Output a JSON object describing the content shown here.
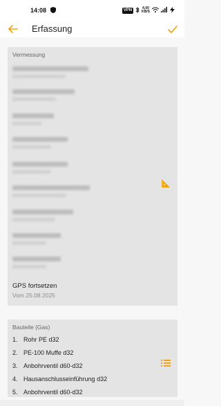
{
  "status_bar": {
    "time": "14:08",
    "vpn": "VPN",
    "speed_value": "4,00",
    "speed_unit": "KB/S"
  },
  "app_bar": {
    "title": "Erfassung"
  },
  "measurement": {
    "label": "Vermessung",
    "gps_title": "GPS fortsetzen",
    "gps_date": "Vom 25.08.2025"
  },
  "parts": {
    "label": "Bauteile (Gas)",
    "items": [
      {
        "num": "1.",
        "name": "Rohr PE d32"
      },
      {
        "num": "2.",
        "name": "PE-100 Muffe d32"
      },
      {
        "num": "3.",
        "name": "Anbohrventil d60-d32"
      },
      {
        "num": "4.",
        "name": "Hausanschlusseinführung d32"
      },
      {
        "num": "5.",
        "name": "Anbohrventil d60-d32"
      }
    ]
  },
  "colors": {
    "accent": "#f0a30a",
    "card_bg": "#e4e4e4"
  }
}
